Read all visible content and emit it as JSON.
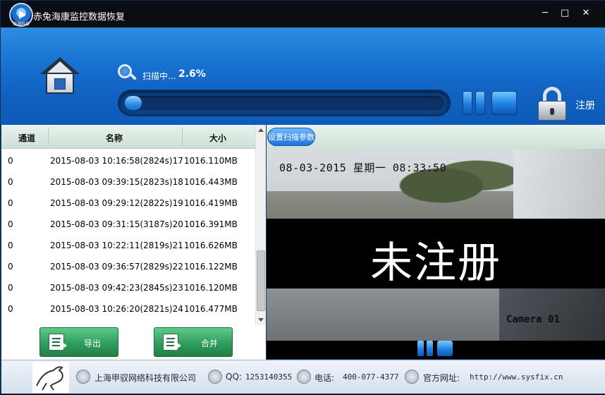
{
  "window": {
    "logo_text": "海源科技",
    "title": "赤兔海康监控数据恢复",
    "controls": {
      "minimize": "─",
      "maximize": "□",
      "close": "✕"
    }
  },
  "header": {
    "scan_label": "扫描中...",
    "scan_percent": "2.6%",
    "progress_fraction": 0.026,
    "register_label": "注册"
  },
  "list": {
    "columns": [
      "通道",
      "名称",
      "大小"
    ],
    "rows": [
      {
        "channel": "0",
        "name": "2015-08-03 10:16:58(2824s)17",
        "size": "1016.110MB"
      },
      {
        "channel": "0",
        "name": "2015-08-03 09:39:15(2823s)18",
        "size": "1016.443MB"
      },
      {
        "channel": "0",
        "name": "2015-08-03 09:29:12(2822s)19",
        "size": "1016.419MB"
      },
      {
        "channel": "0",
        "name": "2015-08-03 09:31:15(3187s)20",
        "size": "1016.391MB"
      },
      {
        "channel": "0",
        "name": "2015-08-03 10:22:11(2819s)21",
        "size": "1016.626MB"
      },
      {
        "channel": "0",
        "name": "2015-08-03 09:36:57(2829s)22",
        "size": "1016.122MB"
      },
      {
        "channel": "0",
        "name": "2015-08-03 09:42:23(2845s)23",
        "size": "1016.120MB"
      },
      {
        "channel": "0",
        "name": "2015-08-03 10:26:20(2821s)24",
        "size": "1016.477MB"
      }
    ],
    "export_label": "导出",
    "merge_label": "合并"
  },
  "preview": {
    "settings_label": "设置扫描参数",
    "osd_date": "08-03-2015 星期一 08:33:50",
    "watermark": "未注册",
    "osd_camera": "Camera 01"
  },
  "footer": {
    "company": "上海甲驭网络科技有限公司",
    "qq_label": "QQ:",
    "qq": "1253140355",
    "phone_label": "电话:",
    "phone": "400-077-4377",
    "site_label": "官方网址:",
    "site": "http://www.sysfix.cn"
  },
  "colors": {
    "header_blue": "#1670cf",
    "export_green": "#2f9d5c",
    "banner_black": "#000000"
  }
}
